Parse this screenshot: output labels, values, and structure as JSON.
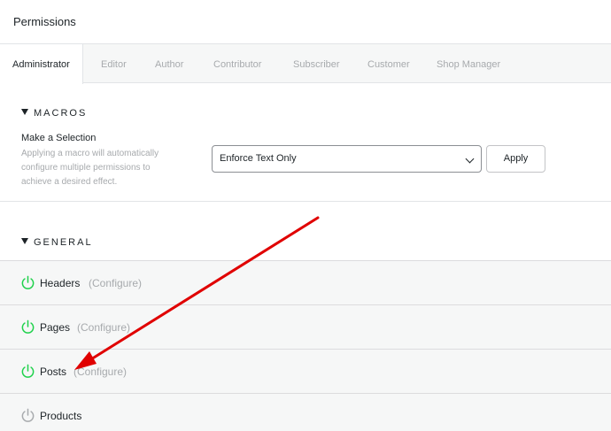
{
  "header": {
    "title": "Permissions"
  },
  "tabs": [
    {
      "label": "Administrator",
      "active": true
    },
    {
      "label": "Editor"
    },
    {
      "label": "Author"
    },
    {
      "label": "Contributor"
    },
    {
      "label": "Subscriber"
    },
    {
      "label": "Customer"
    },
    {
      "label": "Shop Manager"
    }
  ],
  "macros": {
    "heading": "MACROS",
    "label": "Make a Selection",
    "description": "Applying a macro will automatically configure multiple permissions to achieve a desired effect.",
    "selected": "Enforce Text Only",
    "apply_label": "Apply"
  },
  "general": {
    "heading": "GENERAL",
    "rows": [
      {
        "name": "Headers",
        "configure": "(Configure)",
        "enabled": true
      },
      {
        "name": "Pages",
        "configure": "(Configure)",
        "enabled": true
      },
      {
        "name": "Posts",
        "configure": "(Configure)",
        "enabled": true
      },
      {
        "name": "Products",
        "configure": "",
        "enabled": false
      }
    ]
  },
  "colors": {
    "power_on": "#1ed14b",
    "power_off": "#a7aaad",
    "annotation_arrow": "#e00000"
  },
  "icons": {
    "power": "power-icon",
    "chevron": "chevron-down-icon",
    "collapse": "triangle-down-icon"
  }
}
